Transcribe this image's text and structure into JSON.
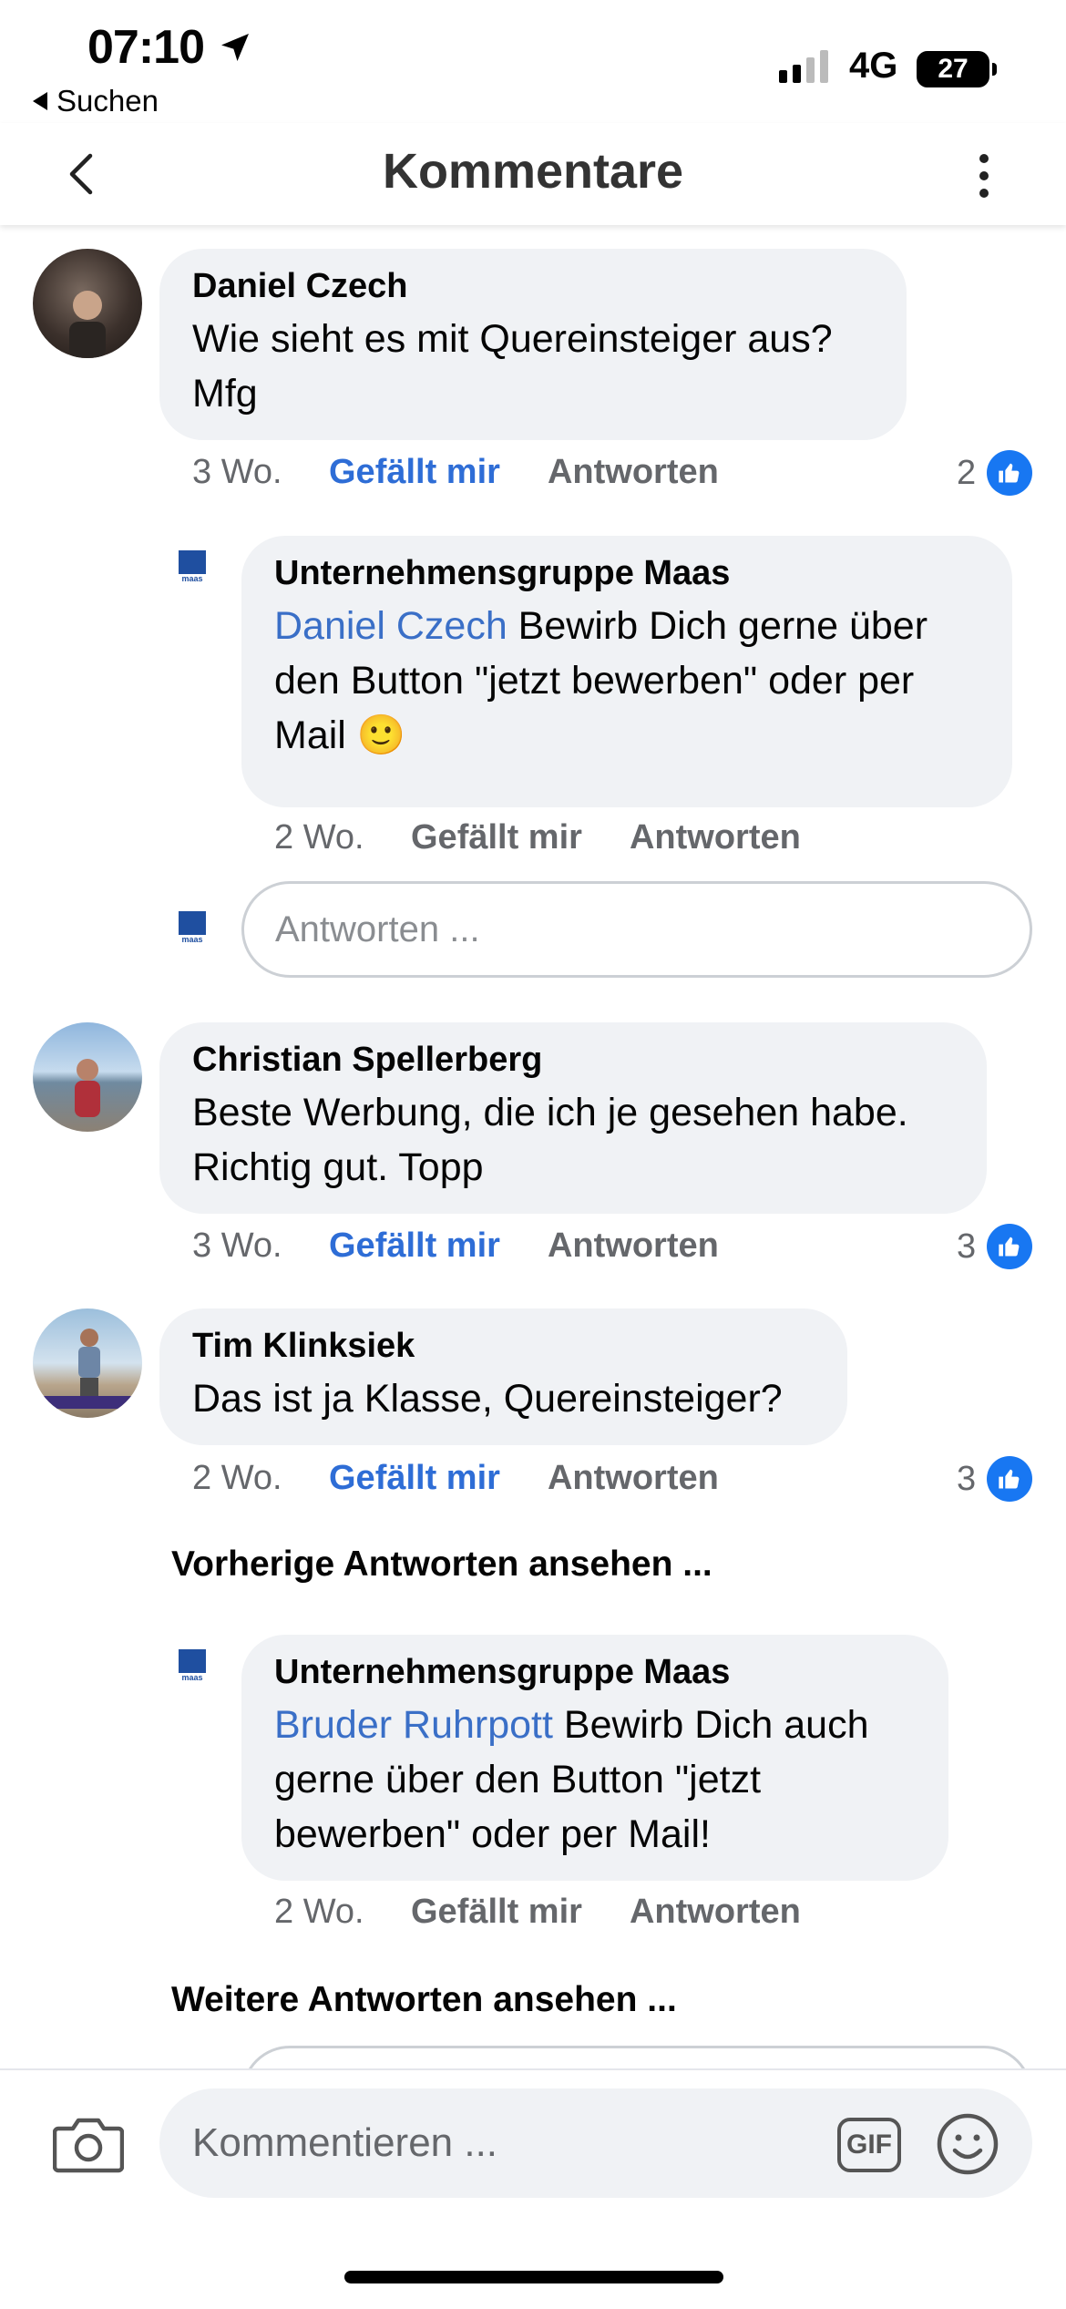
{
  "status_bar": {
    "time": "07:10",
    "back_app_label": "Suchen",
    "network": "4G",
    "battery": "27"
  },
  "header": {
    "title": "Kommentare"
  },
  "comments": [
    {
      "author": "Daniel Czech",
      "text": "Wie sieht es mit Quereinsteiger aus? Mfg",
      "time": "3 Wo.",
      "like_label": "Gefällt mir",
      "reply_label": "Antworten",
      "like_count": "2"
    },
    {
      "author": "Unternehmensgruppe Maas",
      "mention": "Daniel Czech",
      "text": " Bewirb Dich gerne über den Button \"jetzt bewerben\" oder per Mail 🙂",
      "time": "2 Wo.",
      "like_label": "Gefällt mir",
      "reply_label": "Antworten"
    },
    {
      "author": "Christian Spellerberg",
      "text": "Beste Werbung, die ich je gesehen habe. Richtig gut. Topp",
      "time": "3 Wo.",
      "like_label": "Gefällt mir",
      "reply_label": "Antworten",
      "like_count": "3"
    },
    {
      "author": "Tim Klinksiek",
      "text": "Das ist ja Klasse, Quereinsteiger?",
      "time": "2 Wo.",
      "like_label": "Gefällt mir",
      "reply_label": "Antworten",
      "like_count": "3"
    },
    {
      "author": "Unternehmensgruppe Maas",
      "mention": "Bruder Ruhrpott",
      "text": " Bewirb Dich auch gerne über den Button \"jetzt bewerben\" oder per Mail!",
      "time": "2 Wo.",
      "like_label": "Gefällt mir",
      "reply_label": "Antworten"
    }
  ],
  "reply_input": {
    "placeholder": "Antworten ..."
  },
  "see_previous_label": "Vorherige Antworten ansehen ...",
  "see_more_label": "Weitere Antworten ansehen ...",
  "logo_text": "maas",
  "composer": {
    "placeholder": "Kommentieren ...",
    "gif_label": "GIF"
  },
  "colors": {
    "accent_blue": "#2e6dd6",
    "like_blue": "#1877f2",
    "bubble_gray": "#f0f2f5",
    "brand_navy": "#1f4fa0"
  }
}
